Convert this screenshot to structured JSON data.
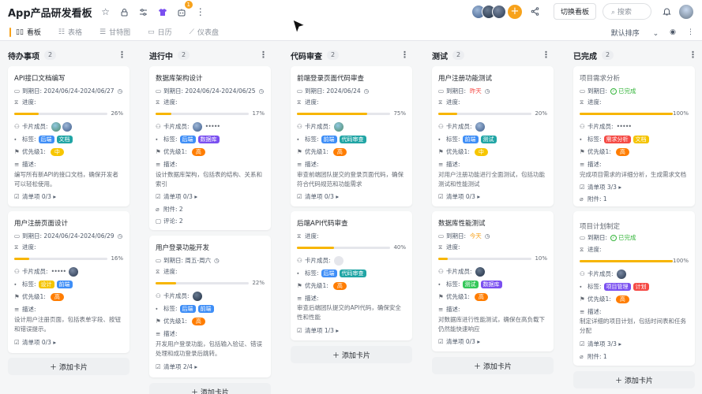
{
  "app": {
    "title": "App产品研发看板",
    "notif_count": "1",
    "switch_btn": "切换看板",
    "search_placeholder": "搜索"
  },
  "tabs": [
    {
      "label": "看板"
    },
    {
      "label": "表格"
    },
    {
      "label": "甘特图"
    },
    {
      "label": "日历"
    },
    {
      "label": "仪表盘"
    }
  ],
  "sort": {
    "label": "默认排序"
  },
  "labels": {
    "due": "到期日:",
    "progress": "进度:",
    "members": "卡片成员:",
    "tags": "标签:",
    "priority": "优先级1:",
    "desc": "描述:",
    "attach": "附件:",
    "comment": "评论:",
    "add_card": "添加卡片"
  },
  "colors": {
    "accent": "#f7a21b",
    "tag_blue": "#3e8ef7",
    "tag_yellow": "#f5c400",
    "tag_teal": "#21a5a5",
    "tag_red": "#f54a45",
    "tag_green": "#34c759",
    "tag_purple": "#7a4ff0",
    "pri_orange": "#ff7d00",
    "pri_yellow": "#f7c600"
  },
  "columns": [
    {
      "name": "待办事项",
      "count": "2",
      "cards": [
        {
          "title": "API接口文档编写",
          "due": "2024/06/24-2024/06/27",
          "pct": "26%",
          "progress": 0.26,
          "tags": [
            "后端",
            "文档"
          ],
          "priority": "中",
          "desc": "编写所有新API的接口文档，确保开发者可以轻松使用。",
          "checklist": "清单项 0/3"
        },
        {
          "title": "用户注册页面设计",
          "due": "2024/06/24-2024/06/29",
          "pct": "16%",
          "progress": 0.16,
          "tags": [
            "设计",
            "前端"
          ],
          "priority": "高",
          "desc": "设计用户注册页面，包括表单字段、按钮和错误提示。",
          "checklist": "清单项 0/3"
        }
      ]
    },
    {
      "name": "进行中",
      "count": "2",
      "cards": [
        {
          "title": "数据库架构设计",
          "due": "2024/06/24-2024/06/25",
          "pct": "17%",
          "progress": 0.17,
          "tags": [
            "后端",
            "数据库"
          ],
          "priority": "高",
          "desc": "设计数据库架构，包括表的结构、关系和索引",
          "checklist": "清单项 0/3",
          "attach": "2",
          "comment": "2"
        },
        {
          "title": "用户登录功能开发",
          "due": "周五-周六",
          "pct": "22%",
          "progress": 0.22,
          "tags": [
            "后端",
            "前端"
          ],
          "priority": "高",
          "desc": "开发用户登录功能，包括输入验证、错误处理和成功登录后跳转。",
          "checklist": "清单项 2/4"
        }
      ]
    },
    {
      "name": "代码审查",
      "count": "2",
      "cards": [
        {
          "title": "前端登录页面代码审查",
          "due": "2024/06/24",
          "pct": "75%",
          "progress": 0.75,
          "tags": [
            "前端",
            "代码审查"
          ],
          "priority": "高",
          "desc": "审查前端团队提交的登录页面代码，确保符合代码规范和功能需求",
          "checklist": "清单项 0/3"
        },
        {
          "title": "后端API代码审查",
          "due": "",
          "pct": "40%",
          "progress": 0.4,
          "tags": [
            "后端",
            "代码审查"
          ],
          "priority": "高",
          "desc": "审查后端团队提交的API代码，确保安全性和性能",
          "checklist": "清单项 1/3"
        }
      ]
    },
    {
      "name": "测试",
      "count": "2",
      "cards": [
        {
          "title": "用户注册功能测试",
          "due": "昨天",
          "pct": "20%",
          "progress": 0.2,
          "tags": [
            "前端",
            "测试"
          ],
          "priority": "中",
          "desc": "对用户注册功能进行全面测试，包括功能测试和性能测试",
          "checklist": "清单项 0/3"
        },
        {
          "title": "数据库性能测试",
          "due": "今天",
          "pct": "10%",
          "progress": 0.1,
          "tags": [
            "测试",
            "数据库"
          ],
          "priority": "高",
          "desc": "对数据库进行性能测试，确保在高负载下仍然能快速响应",
          "checklist": "清单项 0/3"
        }
      ]
    },
    {
      "name": "已完成",
      "count": "2",
      "cards": [
        {
          "title": "项目需求分析",
          "due": "已完成",
          "pct": "100%",
          "progress": 1.0,
          "tags": [
            "需求分析",
            "文档"
          ],
          "priority": "高",
          "desc": "完成项目需求的详细分析，生成需求文档",
          "checklist": "清单项 3/3",
          "attach": "1"
        },
        {
          "title": "项目计划制定",
          "due": "已完成",
          "pct": "100%",
          "progress": 1.0,
          "tags": [
            "项目管理",
            "计划"
          ],
          "priority": "高",
          "desc": "制定详细的项目计划，包括时间表和任务分配",
          "checklist": "清单项 3/3",
          "attach": "1"
        }
      ]
    }
  ]
}
